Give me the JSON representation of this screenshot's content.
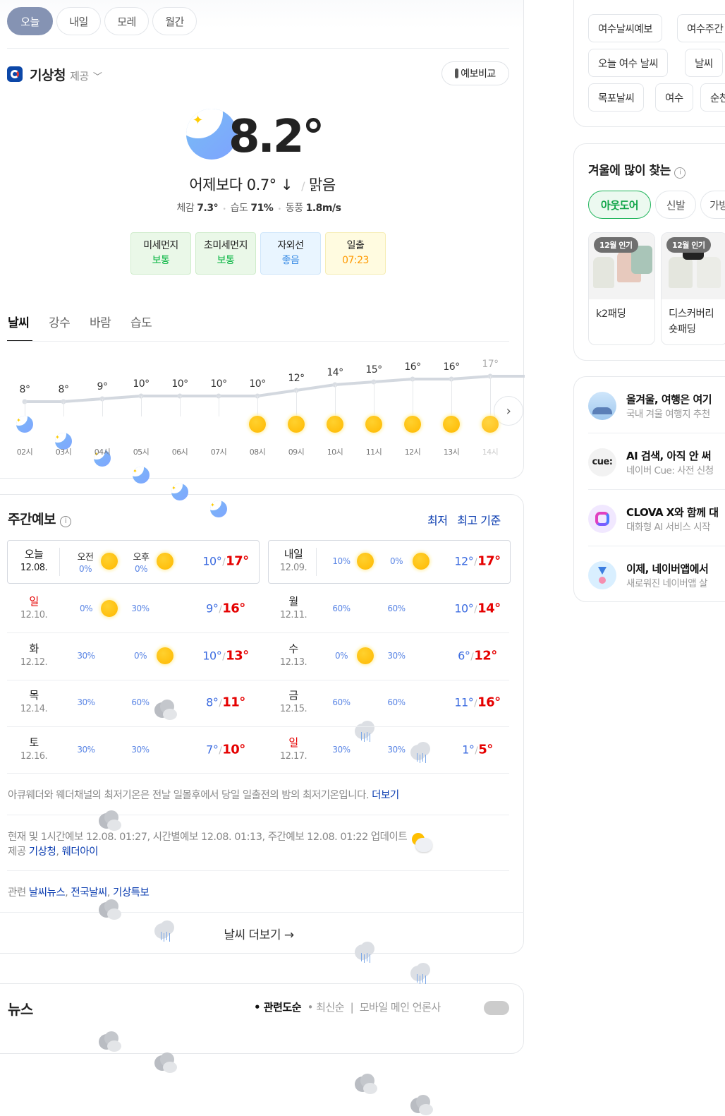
{
  "day_tabs": [
    {
      "label": "오늘",
      "active": true
    },
    {
      "label": "내일"
    },
    {
      "label": "모레"
    },
    {
      "label": "월간"
    }
  ],
  "provider": {
    "name": "기상청",
    "suffix": "제공",
    "compare_button": "예보비교"
  },
  "current": {
    "temperature": "8.2°",
    "vs_yesterday": "어제보다 0.7° ↓",
    "separator": "/",
    "condition": "맑음",
    "details": [
      {
        "label": "체감",
        "value": "7.3°"
      },
      {
        "label": "습도",
        "value": "71%"
      },
      {
        "label": "동풍",
        "value": "1.8m/s"
      }
    ],
    "air": [
      {
        "label": "미세먼지",
        "value": "보통",
        "color": "#00b33c",
        "bg": "#eaf8e8"
      },
      {
        "label": "초미세먼지",
        "value": "보통",
        "color": "#00b33c",
        "bg": "#eaf8e8"
      },
      {
        "label": "자외선",
        "value": "좋음",
        "color": "#3b8de6",
        "bg": "#e9f5ff"
      },
      {
        "label": "일출",
        "value": "07:23",
        "color": "#ff9900",
        "bg": "#fffbe0"
      }
    ]
  },
  "chart_tabs": [
    {
      "label": "날씨",
      "active": true
    },
    {
      "label": "강수"
    },
    {
      "label": "바람"
    },
    {
      "label": "습도"
    }
  ],
  "hourly": [
    {
      "time": "02시",
      "temp": 8,
      "icon": "moon-icon"
    },
    {
      "time": "03시",
      "temp": 8,
      "icon": "moon-icon"
    },
    {
      "time": "04시",
      "temp": 9,
      "icon": "moon-icon"
    },
    {
      "time": "05시",
      "temp": 10,
      "icon": "moon-icon"
    },
    {
      "time": "06시",
      "temp": 10,
      "icon": "moon-icon"
    },
    {
      "time": "07시",
      "temp": 10,
      "icon": "moon-icon"
    },
    {
      "time": "08시",
      "temp": 10,
      "icon": "sun-icon"
    },
    {
      "time": "09시",
      "temp": 12,
      "icon": "sun-icon"
    },
    {
      "time": "10시",
      "temp": 14,
      "icon": "sun-icon"
    },
    {
      "time": "11시",
      "temp": 15,
      "icon": "sun-icon"
    },
    {
      "time": "12시",
      "temp": 16,
      "icon": "sun-icon"
    },
    {
      "time": "13시",
      "temp": 16,
      "icon": "sun-icon"
    },
    {
      "time": "14시",
      "temp": 17,
      "icon": "sun-icon"
    }
  ],
  "weekly": {
    "title": "주간예보",
    "sort_low": "최저",
    "sort_high": "최고 기준",
    "am_label": "오전",
    "pm_label": "오후",
    "days": [
      {
        "day": "오늘",
        "date": "12.08.",
        "am": "0%",
        "am_icon": "sun",
        "pm": "0%",
        "pm_icon": "sun",
        "low": "10°",
        "high": "17°"
      },
      {
        "day": "내일",
        "date": "12.09.",
        "am": "10%",
        "am_icon": "sun",
        "pm": "0%",
        "pm_icon": "sun",
        "low": "12°",
        "high": "17°"
      },
      {
        "day": "일",
        "date": "12.10.",
        "am": "0%",
        "am_icon": "sun",
        "pm": "30%",
        "pm_icon": "cloud",
        "low": "9°",
        "high": "16°",
        "holiday": true
      },
      {
        "day": "월",
        "date": "12.11.",
        "am": "60%",
        "am_icon": "rain",
        "pm": "60%",
        "pm_icon": "rain",
        "low": "10°",
        "high": "14°"
      },
      {
        "day": "화",
        "date": "12.12.",
        "am": "30%",
        "am_icon": "cloud",
        "pm": "0%",
        "pm_icon": "sun",
        "low": "10°",
        "high": "13°"
      },
      {
        "day": "수",
        "date": "12.13.",
        "am": "0%",
        "am_icon": "sun",
        "pm": "30%",
        "pm_icon": "partly",
        "low": "6°",
        "high": "12°"
      },
      {
        "day": "목",
        "date": "12.14.",
        "am": "30%",
        "am_icon": "cloud",
        "pm": "60%",
        "pm_icon": "rain",
        "low": "8°",
        "high": "11°"
      },
      {
        "day": "금",
        "date": "12.15.",
        "am": "60%",
        "am_icon": "rain",
        "pm": "60%",
        "pm_icon": "rain",
        "low": "11°",
        "high": "16°"
      },
      {
        "day": "토",
        "date": "12.16.",
        "am": "30%",
        "am_icon": "cloud",
        "pm": "30%",
        "pm_icon": "cloud",
        "low": "7°",
        "high": "10°"
      },
      {
        "day": "일",
        "date": "12.17.",
        "am": "30%",
        "am_icon": "cloud",
        "pm": "30%",
        "pm_icon": "cloud",
        "low": "1°",
        "high": "5°",
        "holiday": true
      }
    ]
  },
  "notes": {
    "accu": "아큐웨더와 웨더채널의 최저기온은 전날 일몰후에서 당일 일출전의 밤의 최저기온입니다.",
    "more": "더보기",
    "update": "현재 및 1시간예보 12.08. 01:27, 시간별예보 12.08. 01:13, 주간예보 12.08. 01:22 업데이트",
    "provided": "제공",
    "src1": "기상청",
    "src2": "웨더아이",
    "related": "관련",
    "rel1": "날씨뉴스",
    "rel2": "전국날씨",
    "rel3": "기상특보",
    "more_weather": "날씨 더보기 →"
  },
  "news": {
    "title": "뉴스",
    "sort1": "관련도순",
    "sort2": "최신순",
    "mobile": "모바일 메인 언론사"
  },
  "related_searches": [
    "여수날씨예보",
    "여수주간",
    "오늘 여수 날씨",
    "날씨",
    "목포날씨",
    "여수",
    "순천"
  ],
  "winter": {
    "title": "겨울에 많이 찾는",
    "tabs": [
      "아웃도어",
      "신발",
      "가방"
    ],
    "products": [
      {
        "badge": "12월 인기",
        "name": "k2패딩"
      },
      {
        "badge": "12월 인기",
        "name": "디스커버리숏패딩"
      }
    ]
  },
  "services": [
    {
      "title": "올겨울, 여행은 여기",
      "sub": "국내 겨울 여행지 추천"
    },
    {
      "title": "AI 검색, 아직 안 써",
      "sub": "네이버 Cue: 사전 신청",
      "logo": "cue:"
    },
    {
      "title": "CLOVA X와 함께 대",
      "sub": "대화형 AI 서비스 시작"
    },
    {
      "title": "이제, 네이버앱에서",
      "sub": "새로워진 네이버앱 살"
    }
  ]
}
